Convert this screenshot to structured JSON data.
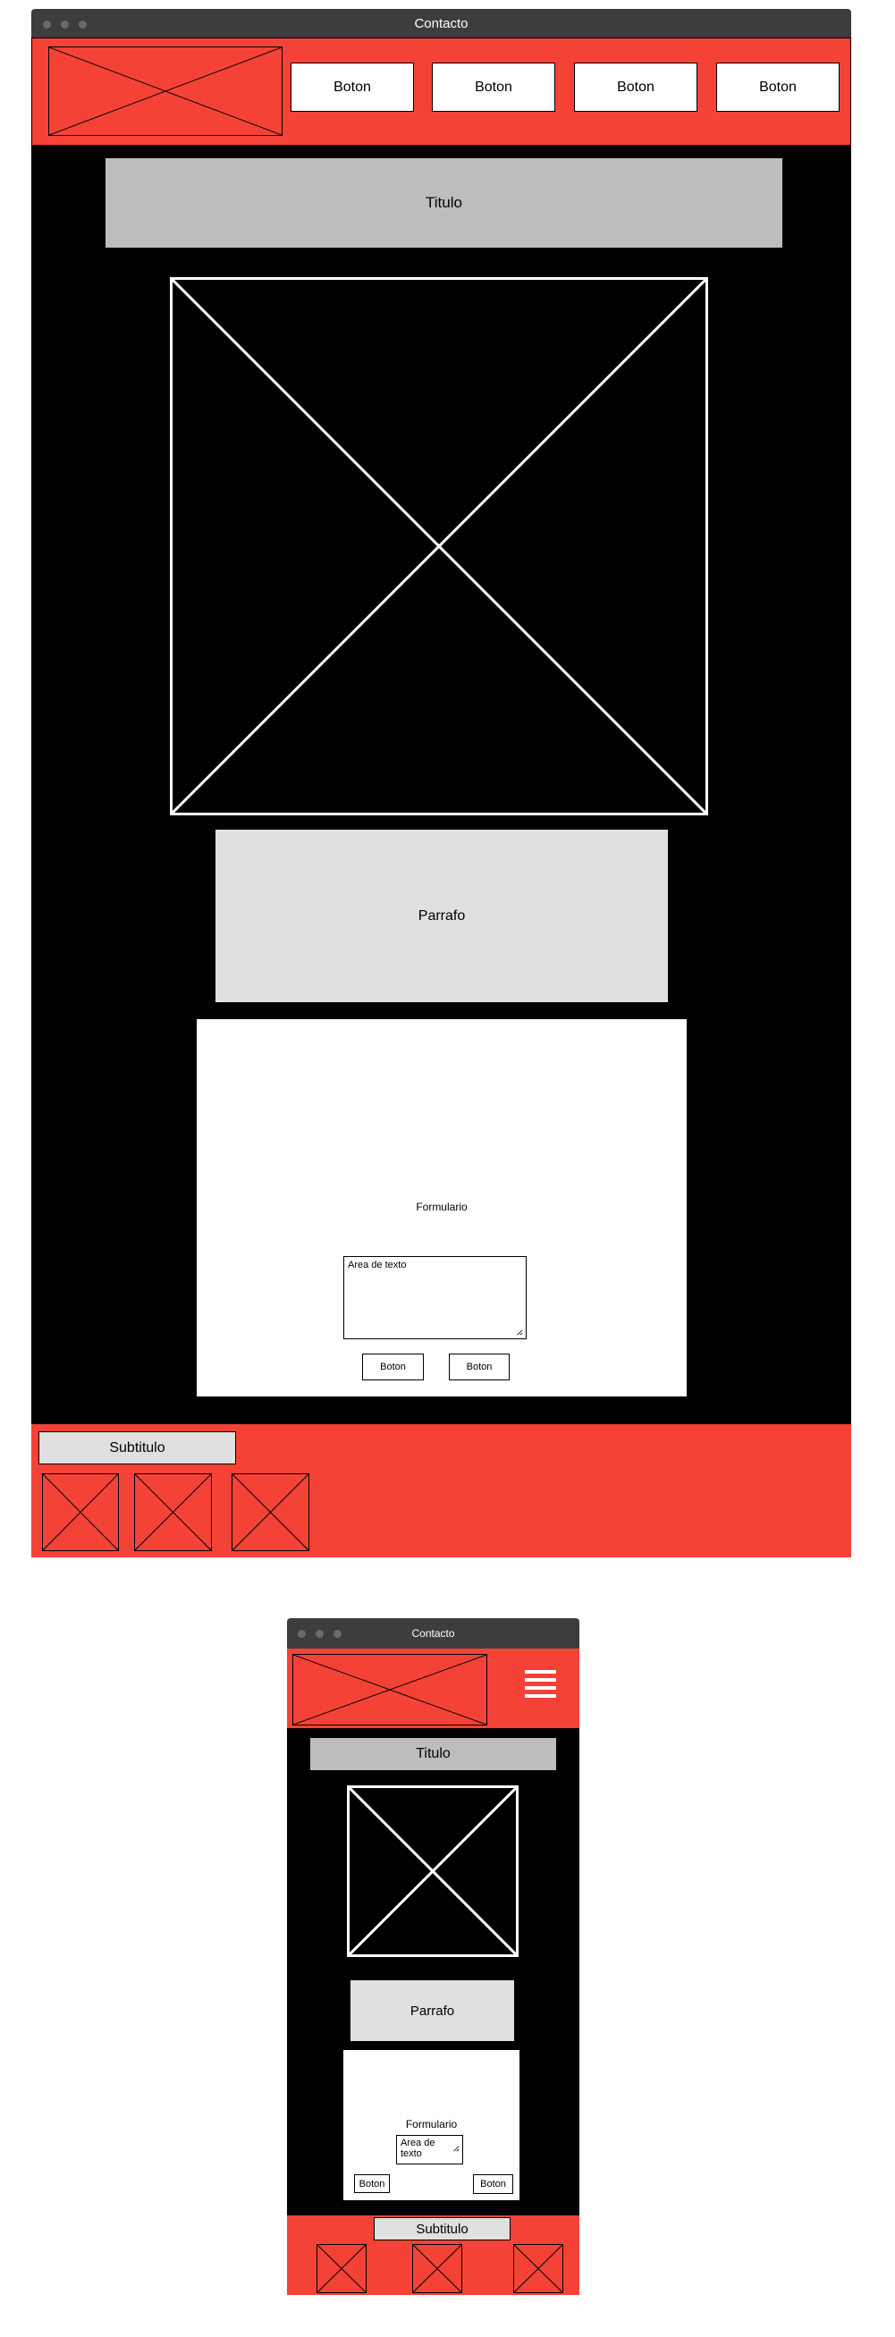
{
  "desktop": {
    "window_title": "Contacto",
    "nav_buttons": [
      "Boton",
      "Boton",
      "Boton",
      "Boton"
    ],
    "title": "Titulo",
    "paragraph": "Parrafo",
    "form": {
      "label": "Formulario",
      "textarea_placeholder": "Area de texto",
      "buttons": [
        "Boton",
        "Boton"
      ]
    },
    "footer": {
      "subtitle": "Subtitulo"
    }
  },
  "mobile": {
    "window_title": "Contacto",
    "title": "Titulo",
    "paragraph": "Parrafo",
    "form": {
      "label": "Formulario",
      "textarea_placeholder": "Area de texto",
      "buttons": [
        "Boton",
        "Boton"
      ]
    },
    "footer": {
      "subtitle": "Subtitulo"
    }
  },
  "colors": {
    "accent": "#f44336",
    "titlebar": "#3d3d3d",
    "content_bg": "#000000",
    "title_bar_bg": "#bdbdbd",
    "paragraph_bg": "#e0e0e0"
  },
  "icons": {
    "image_placeholder": "x-box-placeholder-icon",
    "menu": "hamburger-menu-icon"
  }
}
